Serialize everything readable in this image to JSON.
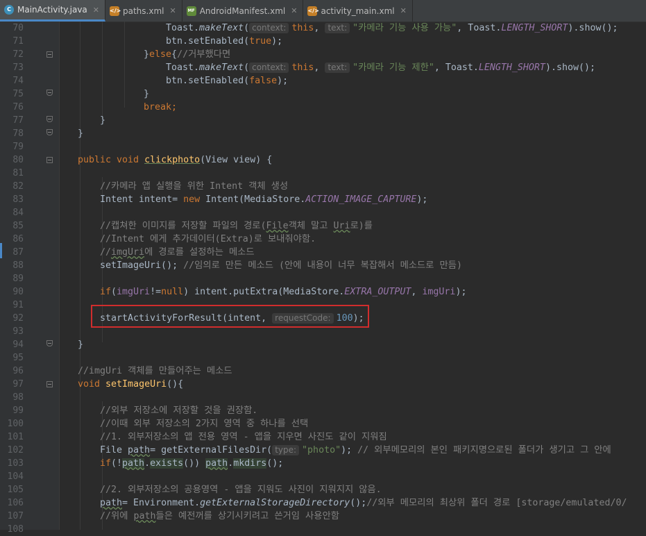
{
  "tabs": [
    {
      "label": "MainActivity.java",
      "icon": "java-class-icon",
      "icon_glyph": "C",
      "active": true
    },
    {
      "label": "paths.xml",
      "icon": "xml-file-icon",
      "icon_glyph": "</>",
      "active": false
    },
    {
      "label": "AndroidManifest.xml",
      "icon": "manifest-file-icon",
      "icon_glyph": "MF",
      "active": false
    },
    {
      "label": "activity_main.xml",
      "icon": "layout-file-icon",
      "icon_glyph": "</>",
      "active": false
    }
  ],
  "close_glyph": "✕",
  "gutter": {
    "line_numbers": [
      "70",
      "71",
      "72",
      "73",
      "74",
      "75",
      "76",
      "77",
      "78",
      "79",
      "80",
      "81",
      "82",
      "83",
      "84",
      "85",
      "86",
      "87",
      "88",
      "89",
      "90",
      "91",
      "92",
      "93",
      "94",
      "95",
      "96",
      "97",
      "98",
      "99",
      "100",
      "101",
      "102",
      "103",
      "104",
      "105",
      "106",
      "107",
      "108"
    ]
  },
  "colors": {
    "keyword": "#cc7832",
    "string": "#6a8759",
    "comment": "#808080",
    "number": "#6897bb",
    "field": "#9876aa",
    "highlight_box": "#d12d2d",
    "active_tab_underline": "#4a88c7"
  },
  "code": {
    "l70": {
      "a": "Toast.",
      "b": "makeText",
      "c": "(",
      "h1": "context:",
      "d": "this",
      "e": ", ",
      "h2": "text:",
      "f": "\"카메라 기능 사용 가능\"",
      "g": ", Toast.",
      "h": "LENGTH_SHORT",
      "i": ").show();"
    },
    "l71": {
      "a": "btn.setEnabled(",
      "b": "true",
      "c": ");"
    },
    "l72": {
      "a": "}",
      "b": "else",
      "c": "{",
      "d": "//거부했다면"
    },
    "l73": {
      "a": "Toast.",
      "b": "makeText",
      "c": "(",
      "h1": "context:",
      "d": "this",
      "e": ", ",
      "h2": "text:",
      "f": "\"카메라 기능 제한\"",
      "g": ", Toast.",
      "h": "LENGTH_SHORT",
      "i": ").show();"
    },
    "l74": {
      "a": "btn.setEnabled(",
      "b": "false",
      "c": ");"
    },
    "l75": {
      "a": "}"
    },
    "l76": {
      "a": "break",
      "b": ";"
    },
    "l77": {
      "a": "}"
    },
    "l78": {
      "a": "}"
    },
    "l80": {
      "a": "public void ",
      "b": "clickphoto",
      "c": "(View view) {"
    },
    "l82": {
      "a": "//카메라 앱 실행을 위한 Intent 객체 생성"
    },
    "l83": {
      "a": "Intent intent= ",
      "b": "new ",
      "c": "Intent(MediaStore.",
      "d": "ACTION_IMAGE_CAPTURE",
      "e": ");"
    },
    "l85": {
      "a": "//캡쳐한 이미지를 저장할 파일의 경로(",
      "b": "File",
      "c": "객체 말고 ",
      "d": "Uri",
      "e": "로)를"
    },
    "l86": {
      "a": "//Intent 에게 추가데이터(Extra)로 보내줘야함."
    },
    "l87": {
      "a": "//",
      "b": "imgUri",
      "c": "에 경로를 설정하는 메소드"
    },
    "l88": {
      "a": "setImageUri(); ",
      "b": "//임의로 만든 메소드 (안에 내용이 너무 복잡해서 메소드로 만듬)"
    },
    "l90": {
      "a": "if",
      "b": "(",
      "c": "imgUri",
      "d": "!=",
      "e": "null",
      "f": ") intent.putExtra(MediaStore.",
      "g": "EXTRA_OUTPUT",
      "h": ", ",
      "i": "imgUri",
      "j": ");"
    },
    "l92": {
      "a": "startActivityForResult(intent, ",
      "h1": "requestCode:",
      "b": "100",
      "c": ");"
    },
    "l94": {
      "a": "}"
    },
    "l96": {
      "a": "//imgUri 객체를 만들어주는 메소드"
    },
    "l97": {
      "a": "void ",
      "b": "setImageUri",
      "c": "(){"
    },
    "l99": {
      "a": "//외부 저장소에 저장할 것을 권장함."
    },
    "l100": {
      "a": "//이때 외부 저장소의 2가지 영역 중 하나를 선택"
    },
    "l101": {
      "a": "//1. 외부저장소의 앱 전용 영역 - 앱을 지우면 사진도 같이 지워짐"
    },
    "l102": {
      "a": "File ",
      "b": "path",
      "c": "= getExternalFilesDir(",
      "h1": "type:",
      "d": "\"photo\"",
      "e": "); ",
      "f": "// 외부메모리의 본인 패키지명으로된 폴더가 생기고 그 안에"
    },
    "l103": {
      "a": "if",
      "b": "(!",
      "c": "path",
      "d": ".",
      "e": "exists",
      "f": "()) ",
      "g": "path",
      "h": ".",
      "i": "mkdirs",
      "j": "();"
    },
    "l105": {
      "a": "//2. 외부저장소의 공용영역 - 앱을 지워도 사진이 지워지지 않음."
    },
    "l106": {
      "a": "path",
      "b": "= Environment.",
      "c": "getExternalStorageDirectory",
      "d": "();",
      "e": "//외부 메모리의 최상위 폴더 경로 [storage/emulated/0/"
    },
    "l107": {
      "a": "//위에 ",
      "b": "path",
      "c": "들은 예전꺼를 상기시키려고 쓴거임 사용안함"
    }
  }
}
